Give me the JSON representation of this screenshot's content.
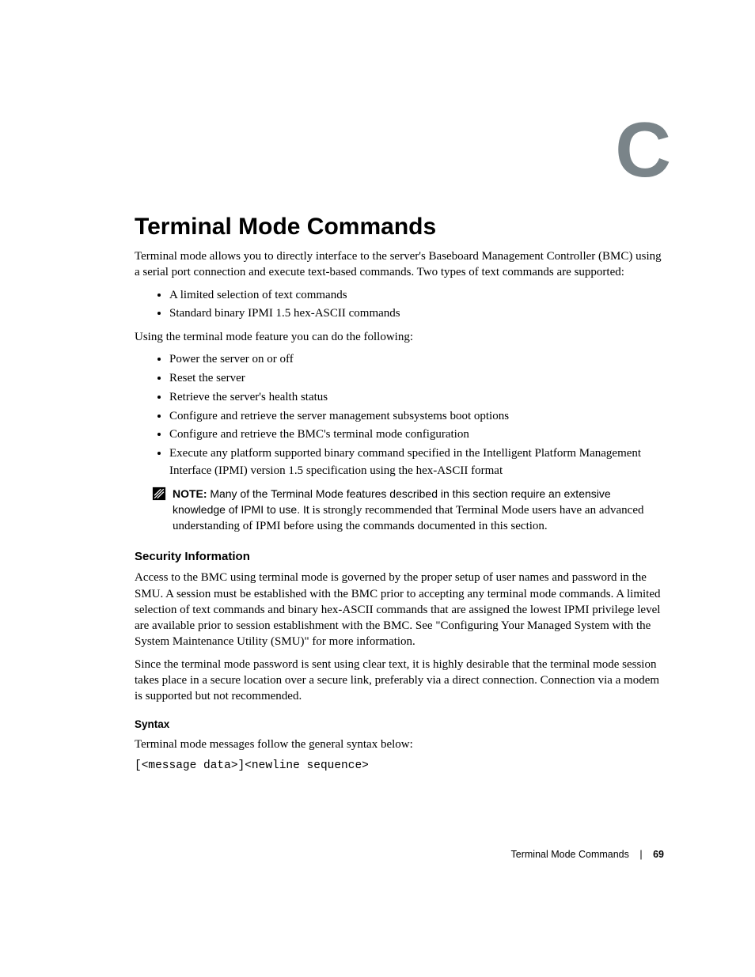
{
  "chapterLetter": "C",
  "title": "Terminal Mode Commands",
  "intro": "Terminal mode allows you to directly interface to the server's Baseboard Management Controller (BMC) using a serial port connection and execute text-based commands. Two types of text commands are supported:",
  "list1": [
    "A limited selection of text commands",
    "Standard binary IPMI 1.5 hex-ASCII commands"
  ],
  "intro2": "Using the terminal mode feature you can do the following:",
  "list2": [
    "Power the server on or off",
    "Reset the server",
    "Retrieve the server's health status",
    "Configure and retrieve the server management subsystems boot options",
    "Configure and retrieve the BMC's terminal mode configuration",
    "Execute any platform supported binary command specified in the Intelligent Platform Management Interface (IPMI) version 1.5 specification using the hex-ASCII format"
  ],
  "note": {
    "label": "NOTE:",
    "strong": "Many of the Terminal Mode features described in this section require an extensive knowledge of IPMI to use. It",
    "rest": " is strongly recommended that Terminal Mode users have an advanced understanding of IPMI before using the commands documented in this section."
  },
  "securityHeading": "Security Information",
  "securityP1": "Access to the BMC using terminal mode is governed by the proper setup of user names and password in the SMU. A session must be established with the BMC prior to accepting any terminal mode commands. A limited selection of text commands and binary hex-ASCII commands that are assigned the lowest IPMI privilege level are available prior to session establishment with the BMC. See \"Configuring Your Managed System with the System Maintenance Utility (SMU)\" for more information.",
  "securityP2": "Since the terminal mode password is sent using clear text, it is highly desirable that the terminal mode session takes place in a secure location over a secure link, preferably via a direct connection. Connection via a modem is supported but not recommended.",
  "syntaxHeading": "Syntax",
  "syntaxP": "Terminal mode messages follow the general syntax below:",
  "syntaxCode": "[<message data>]<newline sequence>",
  "footer": {
    "section": "Terminal Mode Commands",
    "page": "69"
  }
}
